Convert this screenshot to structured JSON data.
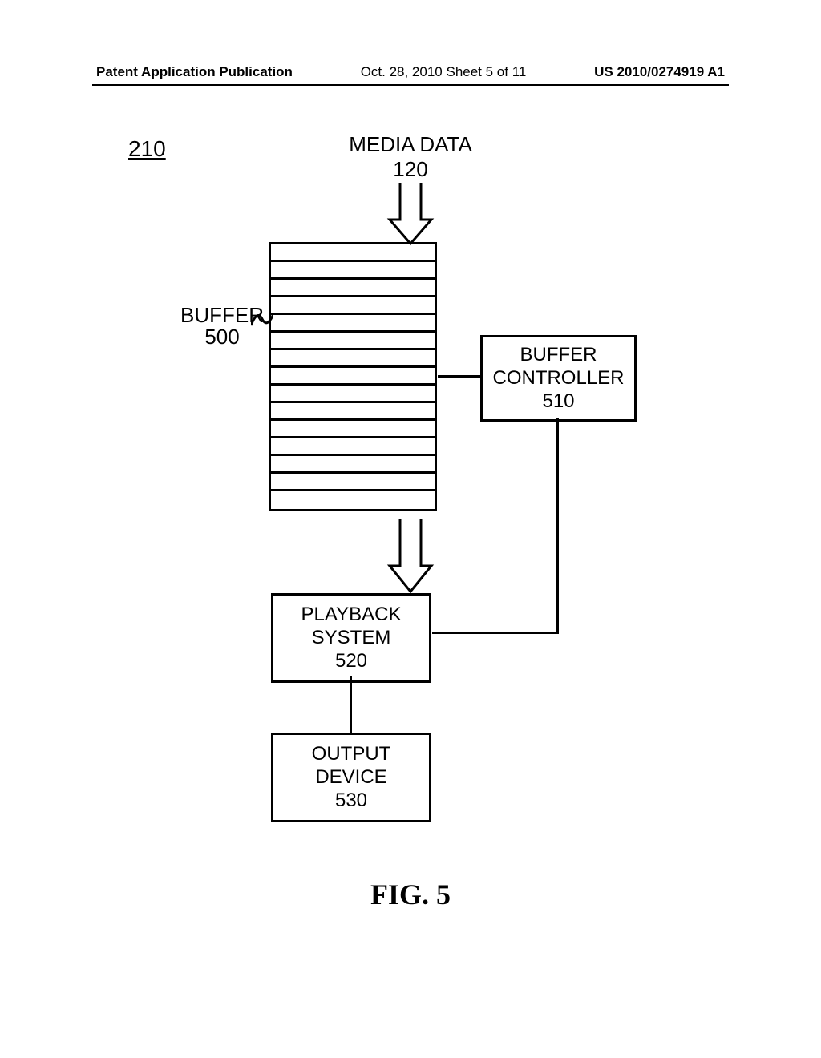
{
  "header": {
    "left": "Patent Application Publication",
    "center": "Oct. 28, 2010  Sheet 5 of 11",
    "right": "US 2010/0274919 A1"
  },
  "ref_210": "210",
  "media_data": {
    "line1": "MEDIA DATA",
    "line2": "120"
  },
  "buffer_label": {
    "line1": "BUFFER",
    "line2": "500"
  },
  "buffer_controller": {
    "line1": "BUFFER",
    "line2": "CONTROLLER",
    "line3": "510"
  },
  "playback": {
    "line1": "PLAYBACK",
    "line2": "SYSTEM",
    "line3": "520"
  },
  "output": {
    "line1": "OUTPUT",
    "line2": "DEVICE",
    "line3": "530"
  },
  "figure_label": "FIG. 5"
}
